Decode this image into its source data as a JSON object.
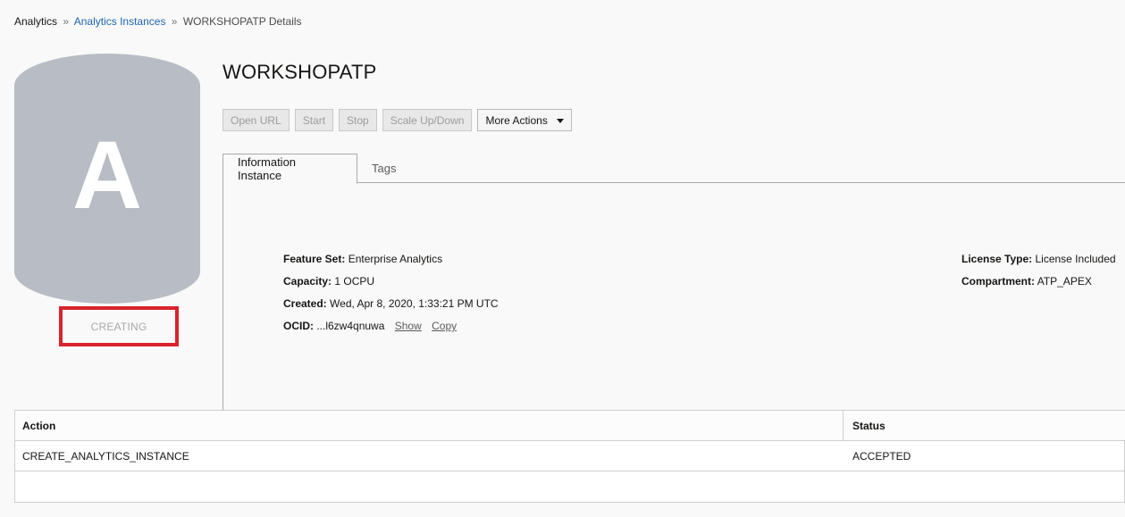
{
  "breadcrumb": {
    "items": [
      "Analytics",
      "Analytics Instances",
      "WORKSHOPATP Details"
    ],
    "separator": "»"
  },
  "instance": {
    "icon_letter": "A",
    "icon_color": "#b8bcc4",
    "status": "CREATING",
    "status_highlight_color": "#d9232d",
    "title": "WORKSHOPATP"
  },
  "toolbar": {
    "open_url": "Open URL",
    "start": "Start",
    "stop": "Stop",
    "scale": "Scale Up/Down",
    "more_actions": "More Actions"
  },
  "tabs": {
    "info": "Information Instance",
    "tags": "Tags"
  },
  "info": {
    "feature_set_label": "Feature Set:",
    "feature_set_value": "Enterprise Analytics",
    "capacity_label": "Capacity:",
    "capacity_value": "1 OCPU",
    "created_label": "Created:",
    "created_value": "Wed, Apr 8, 2020, 1:33:21 PM UTC",
    "ocid_label": "OCID:",
    "ocid_value": "...l6zw4qnuwa",
    "ocid_show": "Show",
    "ocid_copy": "Copy",
    "license_label": "License Type:",
    "license_value": "License Included",
    "compartment_label": "Compartment:",
    "compartment_value": "ATP_APEX"
  },
  "work_requests": {
    "columns": [
      "Action",
      "Status"
    ],
    "rows": [
      {
        "action": "CREATE_ANALYTICS_INSTANCE",
        "status": "ACCEPTED"
      }
    ]
  }
}
